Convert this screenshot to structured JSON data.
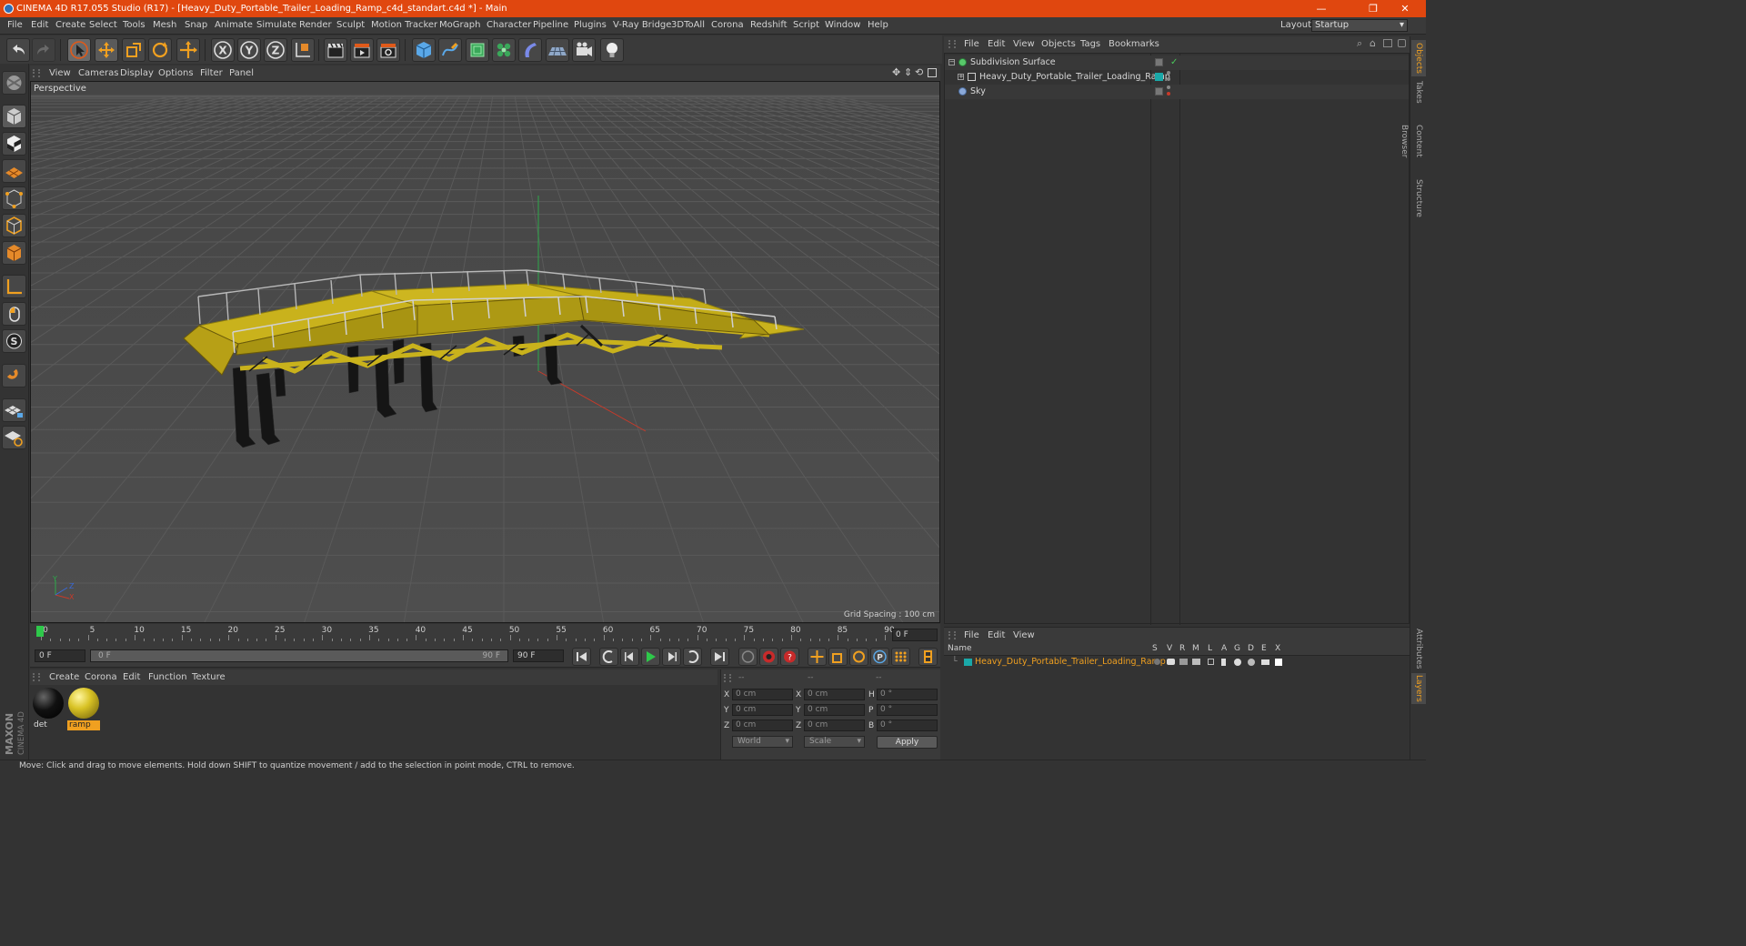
{
  "window": {
    "title": "CINEMA 4D R17.055 Studio (R17) - [Heavy_Duty_Portable_Trailer_Loading_Ramp_c4d_standart.c4d *] - Main",
    "minimize": "—",
    "restore": "❐",
    "close": "✕"
  },
  "menubar": {
    "items": [
      "File",
      "Edit",
      "Create",
      "Select",
      "Tools",
      "Mesh",
      "Snap",
      "Animate",
      "Simulate",
      "Render",
      "Sculpt",
      "Motion Tracker",
      "MoGraph",
      "Character",
      "Pipeline",
      "Plugins",
      "V-Ray Bridge",
      "3DToAll",
      "Corona",
      "Redshift",
      "Script",
      "Window",
      "Help"
    ],
    "layout_label": "Layout:",
    "layout_value": "Startup"
  },
  "viewport": {
    "menu": [
      "View",
      "Cameras",
      "Display",
      "Options",
      "Filter",
      "Panel"
    ],
    "label": "Perspective",
    "grid_spacing": "Grid Spacing : 100 cm",
    "axis_x": "X",
    "axis_y": "Y",
    "axis_z": "Z"
  },
  "timeline": {
    "ticks": [
      "0",
      "5",
      "10",
      "15",
      "20",
      "25",
      "30",
      "35",
      "40",
      "45",
      "50",
      "55",
      "60",
      "65",
      "70",
      "75",
      "80",
      "85",
      "90"
    ],
    "current_frame": "0 F"
  },
  "transport": {
    "start_field": "0 F",
    "range_left": "0 F",
    "range_right": "90 F",
    "end_field": "90 F"
  },
  "materials": {
    "menu": [
      "Create",
      "Corona",
      "Edit",
      "Function",
      "Texture"
    ],
    "items": [
      {
        "name": "det",
        "color": "#111111"
      },
      {
        "name": "ramp",
        "color": "#d8c224"
      }
    ]
  },
  "coords": {
    "header": [
      "--",
      "--",
      "--"
    ],
    "rows": [
      {
        "a": "X",
        "av": "0 cm",
        "b": "X",
        "bv": "0 cm",
        "c": "H",
        "cv": "0 °"
      },
      {
        "a": "Y",
        "av": "0 cm",
        "b": "Y",
        "bv": "0 cm",
        "c": "P",
        "cv": "0 °"
      },
      {
        "a": "Z",
        "av": "0 cm",
        "b": "Z",
        "bv": "0 cm",
        "c": "B",
        "cv": "0 °"
      }
    ],
    "space": "World",
    "mode": "Scale",
    "apply": "Apply"
  },
  "object_manager": {
    "menu": [
      "File",
      "Edit",
      "View",
      "Objects",
      "Tags",
      "Bookmarks"
    ],
    "objects": [
      {
        "name": "Subdivision Surface",
        "icon_color": "#58c86a"
      },
      {
        "name": "Heavy_Duty_Portable_Trailer_Loading_Ramp",
        "icon_color": "#bbbbbb"
      },
      {
        "name": "Sky",
        "icon_color": "#8aa8d8"
      }
    ]
  },
  "layer_manager": {
    "menu": [
      "File",
      "Edit",
      "View"
    ],
    "columns": [
      "Name",
      "S",
      "V",
      "R",
      "M",
      "L",
      "A",
      "G",
      "D",
      "E",
      "X"
    ],
    "layer_name": "Heavy_Duty_Portable_Trailer_Loading_Ramp",
    "layer_color": "#1aa8a8"
  },
  "right_tabs": [
    "Objects",
    "Takes",
    "Content Browser",
    "Structure",
    "Attributes",
    "Layers"
  ],
  "status": "Move: Click and drag to move elements. Hold down SHIFT to quantize movement / add to the selection in point mode, CTRL to remove.",
  "brand": {
    "maxon": "MAXON",
    "product": "CINEMA 4D"
  },
  "colors": {
    "accent": "#e0470f",
    "highlight": "#f0a020",
    "model": "#c9b21c"
  }
}
